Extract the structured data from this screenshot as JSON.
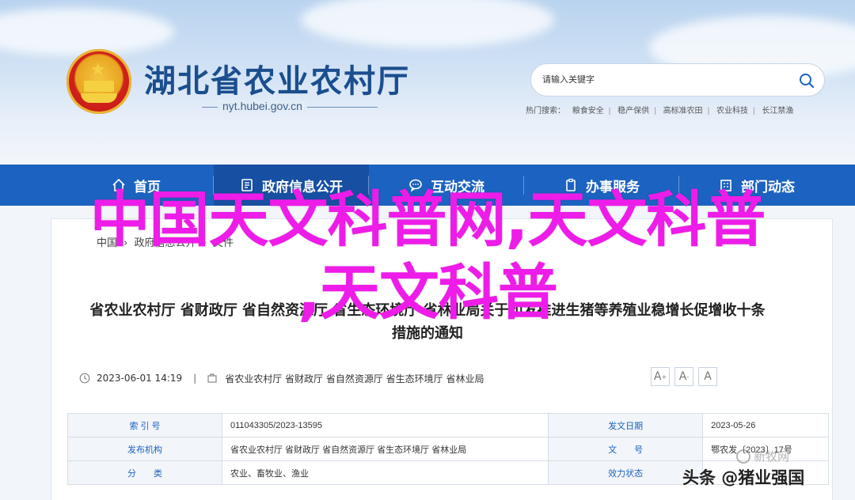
{
  "header": {
    "site_title": "湖北省农业农村厅",
    "site_url": "nyt.hubei.gov.cn",
    "search_placeholder": "请输入关键字",
    "hot_search_label": "热门搜索：",
    "hot_search_items": [
      "粮食安全",
      "稳产保供",
      "高标准农田",
      "农业科技",
      "长江禁渔"
    ]
  },
  "nav": {
    "items": [
      {
        "label": "首页",
        "icon": "home-icon"
      },
      {
        "label": "政府信息公开",
        "icon": "document-icon"
      },
      {
        "label": "互动交流",
        "icon": "chat-icon"
      },
      {
        "label": "办事服务",
        "icon": "clipboard-icon"
      },
      {
        "label": "部门动态",
        "icon": "building-icon"
      }
    ]
  },
  "breadcrumb": {
    "items": [
      "中国",
      "政府信息公开",
      "文件"
    ]
  },
  "article": {
    "title_line1": "省农业农村厅 省财政厅 省自然资源厅 省生态环境厅 省林业局关于印发推进生猪等养殖业稳增长促增收十条",
    "title_line2": "措施的通知",
    "date": "2023-06-01 14:19",
    "pipe": "|",
    "publishers": "省农业农村厅 省财政厅 省自然资源厅 省生态环境厅 省林业局",
    "font_buttons": [
      "A",
      "A",
      "A"
    ]
  },
  "info_table": {
    "rows": [
      {
        "label1": "索 引 号",
        "value1": "011043305/2023-13595",
        "label2": "发文日期",
        "value2": "2023-05-26"
      },
      {
        "label1": "发布机构",
        "value1": "省农业农村厅 省财政厅 省自然资源厅 省生态环境厅 省林业局",
        "label2": "文　　号",
        "value2": "鄂农发〔2023〕17号"
      },
      {
        "label1": "分　　类",
        "value1": "农业、畜牧业、渔业",
        "label2": "效力状态",
        "value2": ""
      }
    ]
  },
  "overlay": {
    "line1": "中国天文科普网,天文科普",
    "line2": ",天文科普"
  },
  "watermark": "新牧网",
  "source_tag": "头条 @猪业强国",
  "colors": {
    "nav_blue": "#1c62c0",
    "title_blue": "#1a4e8e",
    "overlay_magenta": "#ee1ce8"
  }
}
